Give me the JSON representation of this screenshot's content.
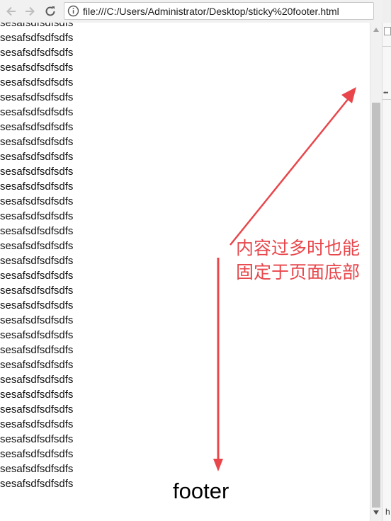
{
  "browser": {
    "url": "file:///C:/Users/Administrator/Desktop/sticky%20footer.html"
  },
  "content": {
    "lines": [
      "sesafsdfsdfsdfs",
      "sesafsdfsdfsdfs",
      "sesafsdfsdfsdfs",
      "sesafsdfsdfsdfs",
      "sesafsdfsdfsdfs",
      "sesafsdfsdfsdfs",
      "sesafsdfsdfsdfs",
      "sesafsdfsdfsdfs",
      "sesafsdfsdfsdfs",
      "sesafsdfsdfsdfs",
      "sesafsdfsdfsdfs",
      "sesafsdfsdfsdfs",
      "sesafsdfsdfsdfs",
      "sesafsdfsdfsdfs",
      "sesafsdfsdfsdfs",
      "sesafsdfsdfsdfs",
      "sesafsdfsdfsdfs",
      "sesafsdfsdfsdfs",
      "sesafsdfsdfsdfs",
      "sesafsdfsdfsdfs",
      "sesafsdfsdfsdfs",
      "sesafsdfsdfsdfs",
      "sesafsdfsdfsdfs",
      "sesafsdfsdfsdfs",
      "sesafsdfsdfsdfs",
      "sesafsdfsdfsdfs",
      "sesafsdfsdfsdfs",
      "sesafsdfsdfsdfs",
      "sesafsdfsdfsdfs",
      "sesafsdfsdfsdfs",
      "sesafsdfsdfsdfs",
      "sesafsdfsdfsdfs"
    ],
    "footer": "footer"
  },
  "annotation": {
    "line1": "内容过多时也能",
    "line2": "固定于页面底部",
    "color": "#e8464b"
  },
  "side_panel": {
    "letter": "h"
  },
  "icons": [
    "back-arrow-icon",
    "forward-arrow-icon",
    "reload-icon",
    "info-icon",
    "scroll-up-icon",
    "scroll-down-icon"
  ]
}
